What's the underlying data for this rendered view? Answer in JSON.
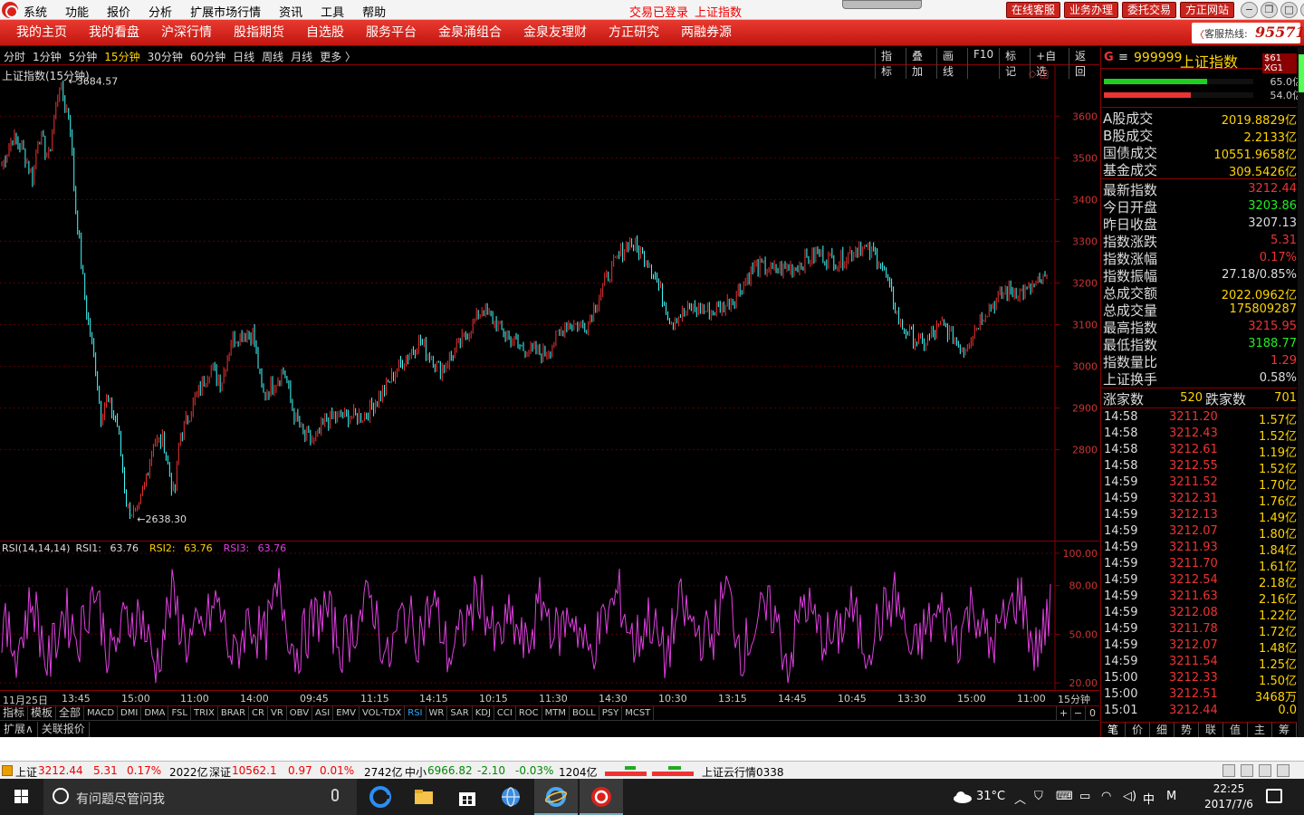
{
  "titlebar": {
    "menu": [
      "系统",
      "功能",
      "报价",
      "分析",
      "扩展市场行情",
      "资讯",
      "工具",
      "帮助"
    ],
    "login_status": "交易已登录",
    "current_index": "上证指数",
    "buttons": [
      "在线客服",
      "业务办理",
      "委托交易",
      "方正网站"
    ],
    "window_controls": [
      "−",
      "❐",
      "□",
      "✕"
    ]
  },
  "navbar": {
    "items": [
      "我的主页",
      "我的看盘",
      "沪深行情",
      "股指期货",
      "自选股",
      "服务平台",
      "金泉涌组合",
      "金泉友理财",
      "方正研究",
      "两融券源"
    ],
    "hotline_label": "客服热线:",
    "hotline_number": "95571"
  },
  "periodbar": {
    "periods": [
      "分时",
      "1分钟",
      "5分钟",
      "15分钟",
      "30分钟",
      "60分钟",
      "日线",
      "周线",
      "月线",
      "更多 〉"
    ],
    "active": "15分钟",
    "tools": [
      "指标",
      "叠加",
      "画线",
      "F10",
      "标记",
      "+自选",
      "返回"
    ]
  },
  "mainchart": {
    "title": "上证指数(15分钟)",
    "high_label": "3684.57",
    "low_label": "2638.30",
    "icons": "◇ ◫"
  },
  "rsi": {
    "label": "RSI(14,14,14)",
    "rsi1_label": "RSI1:",
    "rsi1": "63.76",
    "rsi2_label": "RSI2:",
    "rsi2": "63.76",
    "rsi3_label": "RSI3:",
    "rsi3": "63.76"
  },
  "time_axis": {
    "labels": [
      "11月25日",
      "13:45",
      "15:00",
      "11:00",
      "14:00",
      "09:45",
      "11:15",
      "14:15",
      "10:15",
      "11:30",
      "14:30",
      "10:30",
      "13:15",
      "14:45",
      "10:45",
      "13:30",
      "15:00",
      "11:00"
    ],
    "timeframe": "15分钟"
  },
  "indicator_tabs": {
    "items": [
      "指标",
      "模板",
      "全部",
      "MACD",
      "DMI",
      "DMA",
      "FSL",
      "TRIX",
      "BRAR",
      "CR",
      "VR",
      "OBV",
      "ASI",
      "EMV",
      "VOL-TDX",
      "RSI",
      "WR",
      "SAR",
      "KDJ",
      "CCI",
      "ROC",
      "MTM",
      "BOLL",
      "PSY",
      "MCST"
    ],
    "active": "RSI",
    "zoom": [
      "+",
      "−",
      "0"
    ]
  },
  "extbar": {
    "items": [
      "扩展∧",
      "关联报价"
    ]
  },
  "rightpanel": {
    "head": {
      "g": "G",
      "menu": "≡",
      "code": "999999",
      "name": "上证指数",
      "tag": "$61 XG1"
    },
    "bars": [
      {
        "value": "65.0亿",
        "color": "#1fcf1f",
        "fill": 0.69
      },
      {
        "value": "54.0亿",
        "color": "#e33",
        "fill": 0.58
      }
    ],
    "turnover": [
      {
        "label": "A股成交",
        "value": "2019.8829亿",
        "color": "#ffd400"
      },
      {
        "label": "B股成交",
        "value": "2.2133亿",
        "color": "#ffd400"
      },
      {
        "label": "国债成交",
        "value": "10551.9658亿",
        "color": "#ffd400"
      },
      {
        "label": "基金成交",
        "value": "309.5426亿",
        "color": "#ffd400"
      }
    ],
    "stats": [
      {
        "label": "最新指数",
        "value": "3212.44",
        "color": "#e33"
      },
      {
        "label": "今日开盘",
        "value": "3203.86",
        "color": "#2e2"
      },
      {
        "label": "昨日收盘",
        "value": "3207.13",
        "color": "#ddd"
      },
      {
        "label": "指数涨跌",
        "value": "5.31",
        "color": "#e33"
      },
      {
        "label": "指数涨幅",
        "value": "0.17%",
        "color": "#e33"
      },
      {
        "label": "指数振幅",
        "value": "27.18/0.85%",
        "color": "#ddd"
      },
      {
        "label": "总成交额",
        "value": "2022.0962亿",
        "color": "#ffd400"
      },
      {
        "label": "总成交量",
        "value": "175809287",
        "color": "#ffd400"
      },
      {
        "label": "最高指数",
        "value": "3215.95",
        "color": "#e33"
      },
      {
        "label": "最低指数",
        "value": "3188.77",
        "color": "#2e2"
      },
      {
        "label": "指数量比",
        "value": "1.29",
        "color": "#e33"
      },
      {
        "label": "上证换手",
        "value": "0.58%",
        "color": "#ddd"
      }
    ],
    "updown": {
      "up_label": "涨家数",
      "up": "520",
      "down_label": "跌家数",
      "down": "701"
    },
    "ticks": [
      {
        "time": "14:58",
        "price": "3211.20",
        "vol": "1.57亿"
      },
      {
        "time": "14:58",
        "price": "3212.43",
        "vol": "1.52亿"
      },
      {
        "time": "14:58",
        "price": "3212.61",
        "vol": "1.19亿"
      },
      {
        "time": "14:58",
        "price": "3212.55",
        "vol": "1.52亿"
      },
      {
        "time": "14:59",
        "price": "3211.52",
        "vol": "1.70亿"
      },
      {
        "time": "14:59",
        "price": "3212.31",
        "vol": "1.76亿"
      },
      {
        "time": "14:59",
        "price": "3212.13",
        "vol": "1.49亿"
      },
      {
        "time": "14:59",
        "price": "3212.07",
        "vol": "1.80亿"
      },
      {
        "time": "14:59",
        "price": "3211.93",
        "vol": "1.84亿"
      },
      {
        "time": "14:59",
        "price": "3211.70",
        "vol": "1.61亿"
      },
      {
        "time": "14:59",
        "price": "3212.54",
        "vol": "2.18亿"
      },
      {
        "time": "14:59",
        "price": "3211.63",
        "vol": "2.16亿"
      },
      {
        "time": "14:59",
        "price": "3212.08",
        "vol": "1.22亿"
      },
      {
        "time": "14:59",
        "price": "3211.78",
        "vol": "1.72亿"
      },
      {
        "time": "14:59",
        "price": "3212.07",
        "vol": "1.48亿"
      },
      {
        "time": "14:59",
        "price": "3211.54",
        "vol": "1.25亿"
      },
      {
        "time": "15:00",
        "price": "3212.33",
        "vol": "1.50亿"
      },
      {
        "time": "15:00",
        "price": "3212.51",
        "vol": "3468万"
      },
      {
        "time": "15:01",
        "price": "3212.44",
        "vol": "0.0"
      }
    ],
    "tabs": [
      "笔",
      "价",
      "细",
      "势",
      "联",
      "值",
      "主",
      "筹"
    ],
    "active_tab": "笔"
  },
  "statusbar": {
    "sh_label": "上证",
    "sh_value": "3212.44",
    "sh_change": "5.31",
    "sh_pct": "0.17%",
    "sh_amount": "2022亿",
    "sz_label": "深证",
    "sz_value": "10562.1",
    "sz_change": "0.97",
    "sz_pct": "0.01%",
    "sz_amount": "2742亿",
    "zx_label": "中小",
    "zx_value": "6966.82",
    "zx_change": "-2.10",
    "zx_pct": "-0.03%",
    "zx_amount": "1204亿",
    "cloud": "上证云行情0338"
  },
  "taskbar": {
    "search_placeholder": "有问题尽管问我",
    "weather": "31°C",
    "ime": "中",
    "ime2": "M",
    "time": "22:25",
    "date": "2017/7/6"
  },
  "chart_data": [
    {
      "type": "line",
      "title": "上证指数(15分钟)",
      "xlabel": "",
      "ylabel": "",
      "ylim": [
        2580,
        3720
      ],
      "yticks": [
        2800,
        2900,
        3000,
        3100,
        3200,
        3300,
        3400,
        3500,
        3600
      ],
      "grid": true,
      "x": [
        0,
        0.01,
        0.02,
        0.03,
        0.035,
        0.045,
        0.055,
        0.06,
        0.065,
        0.07,
        0.08,
        0.09,
        0.095,
        0.1,
        0.11,
        0.12,
        0.13,
        0.14,
        0.145,
        0.155,
        0.165,
        0.17,
        0.19,
        0.2,
        0.21,
        0.22,
        0.24,
        0.25,
        0.27,
        0.28,
        0.29,
        0.3,
        0.31,
        0.325,
        0.335,
        0.345,
        0.36,
        0.38,
        0.4,
        0.42,
        0.44,
        0.46,
        0.48,
        0.5,
        0.52,
        0.54,
        0.56,
        0.58,
        0.6,
        0.62,
        0.64,
        0.66,
        0.68,
        0.7,
        0.72,
        0.74,
        0.76,
        0.78,
        0.8,
        0.82,
        0.84,
        0.86,
        0.88,
        0.9,
        0.92,
        0.94,
        0.96,
        0.98,
        1.0
      ],
      "values": [
        3480,
        3550,
        3520,
        3450,
        3560,
        3500,
        3680,
        3630,
        3600,
        3400,
        3150,
        2990,
        2880,
        2920,
        2870,
        2660,
        2640,
        2760,
        2820,
        2820,
        2680,
        2830,
        2950,
        3000,
        2960,
        3070,
        3080,
        2930,
        2990,
        2880,
        2830,
        2820,
        2870,
        2880,
        2880,
        2880,
        2920,
        3000,
        3060,
        2990,
        3060,
        3140,
        3080,
        3040,
        3030,
        3100,
        3100,
        3220,
        3300,
        3250,
        3110,
        3140,
        3130,
        3160,
        3240,
        3230,
        3240,
        3270,
        3250,
        3290,
        3260,
        3100,
        3050,
        3100,
        3040,
        3130,
        3180,
        3180,
        3210
      ],
      "annotations": [
        {
          "label": "3684.57",
          "value": 3684.57
        },
        {
          "label": "2638.30",
          "value": 2638.3
        }
      ]
    },
    {
      "type": "line",
      "title": "RSI(14,14,14)",
      "ylim": [
        15,
        105
      ],
      "yticks": [
        20,
        50,
        80,
        100
      ],
      "series": [
        {
          "name": "RSI3",
          "values": [
            55,
            40,
            72,
            30,
            65,
            48,
            80,
            35,
            58,
            62,
            28,
            74,
            45,
            52,
            70,
            33,
            60,
            46,
            78,
            38,
            55,
            66,
            42,
            57,
            73,
            31,
            63,
            50,
            69,
            36,
            54,
            77,
            44,
            59,
            40,
            71,
            49,
            64,
            37,
            56,
            75,
            43,
            61,
            34,
            68,
            52,
            47,
            79,
            39,
            58,
            65,
            30,
            72,
            51,
            45,
            67,
            41,
            60,
            74,
            36,
            55,
            63,
            48,
            70,
            42,
            57,
            76,
            38,
            64
          ]
        }
      ]
    }
  ]
}
